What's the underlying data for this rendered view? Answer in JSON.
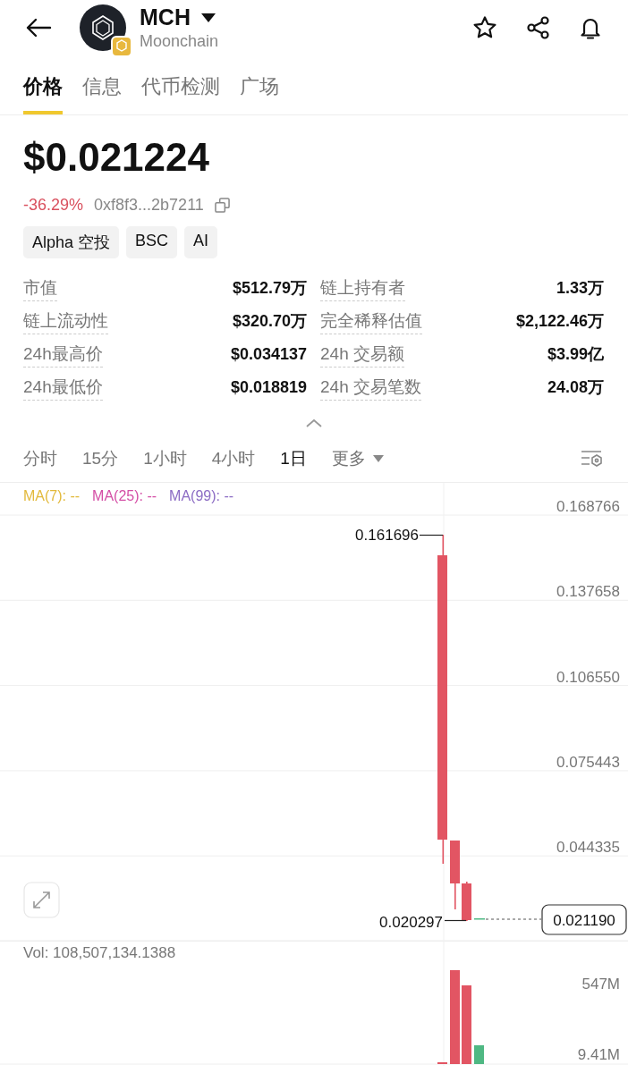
{
  "header": {
    "symbol": "MCH",
    "name": "Moonchain"
  },
  "tabs": [
    {
      "label": "价格",
      "selected": true
    },
    {
      "label": "信息",
      "selected": false
    },
    {
      "label": "代币检测",
      "selected": false
    },
    {
      "label": "广场",
      "selected": false
    }
  ],
  "price": "$0.021224",
  "change": "-36.29%",
  "address": "0xf8f3...2b7211",
  "tags": [
    "Alpha 空投",
    "BSC",
    "AI"
  ],
  "stats": [
    {
      "label": "市值",
      "value": "$512.79万"
    },
    {
      "label": "链上持有者",
      "value": "1.33万"
    },
    {
      "label": "链上流动性",
      "value": "$320.70万"
    },
    {
      "label": "完全稀释估值",
      "value": "$2,122.46万"
    },
    {
      "label": "24h最高价",
      "value": "$0.034137"
    },
    {
      "label": "24h 交易额",
      "value": "$3.99亿"
    },
    {
      "label": "24h最低价",
      "value": "$0.018819"
    },
    {
      "label": "24h 交易笔数",
      "value": "24.08万"
    }
  ],
  "intervals": [
    {
      "label": "分时",
      "selected": false,
      "kind": "plain"
    },
    {
      "label": "15分",
      "selected": false,
      "kind": "plain"
    },
    {
      "label": "1小时",
      "selected": false,
      "kind": "plain"
    },
    {
      "label": "4小时",
      "selected": false,
      "kind": "plain"
    },
    {
      "label": "1日",
      "selected": true,
      "kind": "plain"
    },
    {
      "label": "更多",
      "selected": false,
      "kind": "dropdown"
    }
  ],
  "chart": {
    "moving_averages": [
      {
        "label": "MA(7): --",
        "color": "#e2b93b"
      },
      {
        "label": "MA(25): --",
        "color": "#d44fa6"
      },
      {
        "label": "MA(99): --",
        "color": "#8c6cc4"
      }
    ],
    "price_axis": [
      "0.168766",
      "0.137658",
      "0.106550",
      "0.075443",
      "0.044335"
    ],
    "high_label": "0.161696",
    "low_label": "0.020297",
    "last_price": "0.021190",
    "volume": "Vol: 108,507,134.1388",
    "volume_axis": [
      "547M",
      "9.41M"
    ]
  }
}
